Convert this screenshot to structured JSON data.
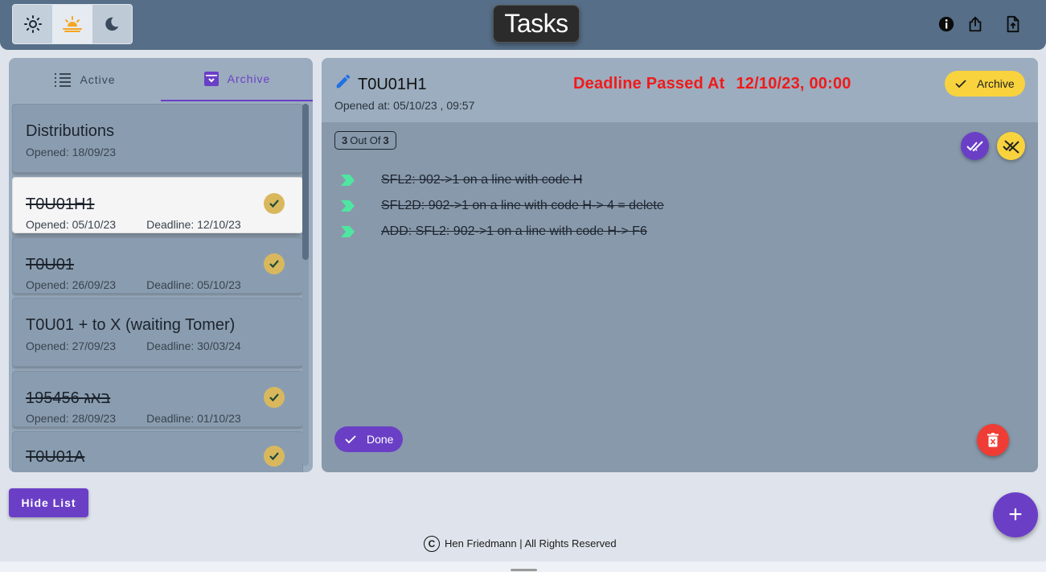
{
  "header": {
    "logo": "Tasks",
    "theme_buttons": [
      "light-mode",
      "sunset-mode",
      "dark-mode"
    ],
    "selected_theme": "sunset-mode"
  },
  "tabs": [
    {
      "label": "Active",
      "icon": "list-icon"
    },
    {
      "label": "Archive",
      "icon": "archive-icon",
      "selected": true
    }
  ],
  "tasks": [
    {
      "title": "Distributions",
      "opened": "Opened: 18/09/23",
      "deadline": "",
      "done": false
    },
    {
      "title": "T0U01H1",
      "opened": "Opened: 05/10/23",
      "deadline": "Deadline: 12/10/23",
      "done": true,
      "selected": true
    },
    {
      "title": "T0U01",
      "opened": "Opened: 26/09/23",
      "deadline": "Deadline: 05/10/23",
      "done": true
    },
    {
      "title": "T0U01 + to X (waiting Tomer)",
      "opened": "Opened: 27/09/23",
      "deadline": "Deadline: 30/03/24",
      "done": false
    },
    {
      "title": "195456 באג",
      "opened": "Opened: 28/09/23",
      "deadline": "Deadline: 01/10/23",
      "done": true
    },
    {
      "title": "T0U01A",
      "opened": "",
      "deadline": "",
      "done": true
    }
  ],
  "detail": {
    "title": "T0U01H1",
    "opened": "Opened at: 05/10/23 , 09:57",
    "deadline_label": "Deadline Passed At",
    "deadline_value": "12/10/23, 00:00",
    "archive_label": "Archive",
    "count_done": "3",
    "count_sep": "Out Of",
    "count_total": "3",
    "subtasks": [
      "SFL2: 902->1 on a line with code H",
      "SFL2D: 902->1 on a line with code H-> 4 = delete",
      "ADD: SFL2: 902->1 on a line with code H-> F6"
    ],
    "done_label": "Done"
  },
  "hide_list_label": "Hide List",
  "fab_label": "+",
  "footer": {
    "copyright_symbol": "C",
    "text": "Hen Friedmann | All Rights Reserved"
  },
  "colors": {
    "accent": "#6a3fc6",
    "deadline": "#ef1b1b",
    "archive": "#f8d33e",
    "check": "#d9b85d",
    "arrow": "#4ee6a0",
    "delete": "#ef3d35"
  }
}
